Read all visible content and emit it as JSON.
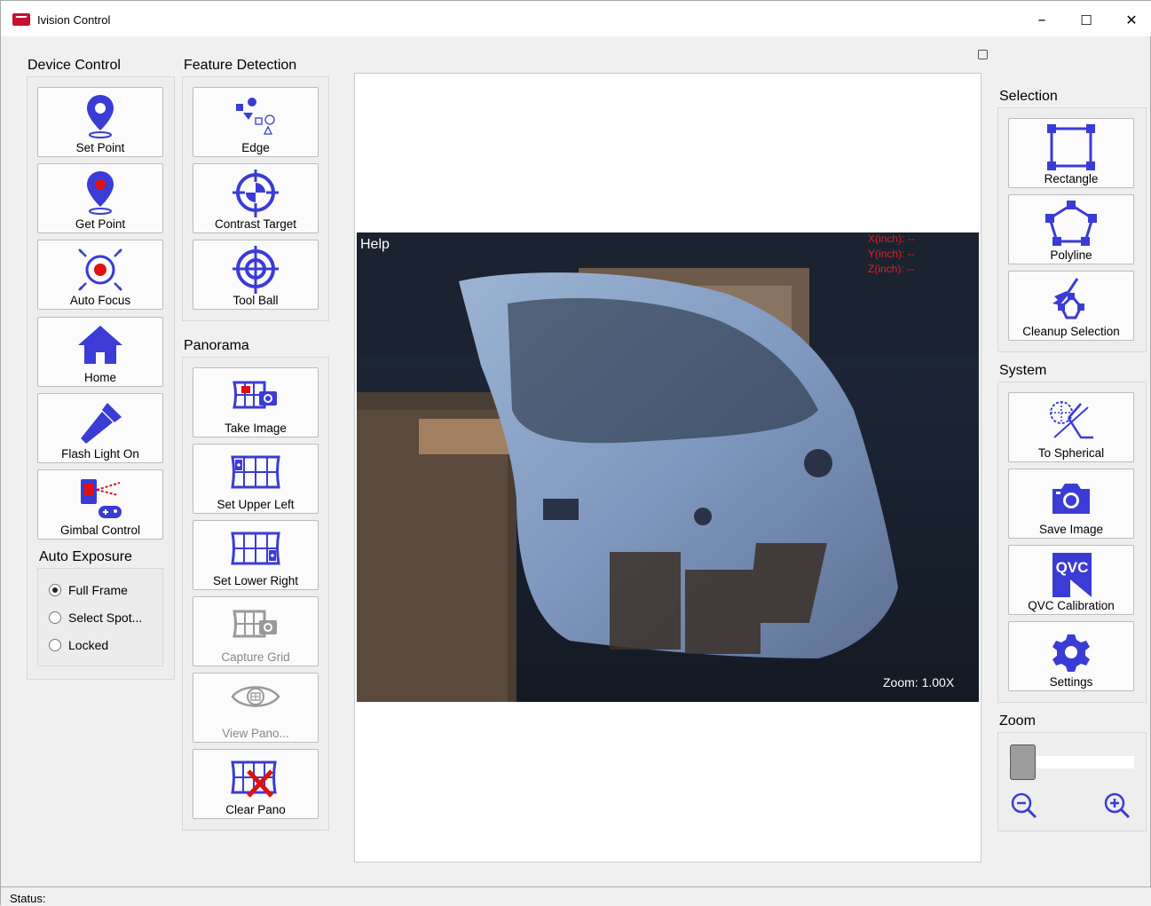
{
  "window": {
    "title": "Ivision Control",
    "min": "–",
    "max": "☐",
    "close": "✕"
  },
  "device_control": {
    "title": "Device Control",
    "buttons": [
      {
        "label": "Set Point",
        "icon": "map-pin-icon"
      },
      {
        "label": "Get Point",
        "icon": "map-pin-red-icon"
      },
      {
        "label": "Auto Focus",
        "icon": "focus-target-icon"
      },
      {
        "label": "Home",
        "icon": "home-icon"
      },
      {
        "label": "Flash Light On",
        "icon": "flashlight-icon"
      },
      {
        "label": "Gimbal Control",
        "icon": "gimbal-gamepad-icon"
      }
    ]
  },
  "auto_exposure": {
    "title": "Auto Exposure",
    "options": [
      {
        "label": "Full Frame",
        "selected": true
      },
      {
        "label": "Select Spot...",
        "selected": false
      },
      {
        "label": "Locked",
        "selected": false
      }
    ]
  },
  "feature_detection": {
    "title": "Feature Detection",
    "buttons": [
      {
        "label": "Edge",
        "icon": "shapes-icon"
      },
      {
        "label": "Contrast Target",
        "icon": "contrast-target-icon"
      },
      {
        "label": "Tool Ball",
        "icon": "crosshair-icon"
      }
    ]
  },
  "panorama": {
    "title": "Panorama",
    "buttons": [
      {
        "label": "Take Image",
        "icon": "pano-camera-icon",
        "enabled": true
      },
      {
        "label": "Set Upper Left",
        "icon": "grid-upper-left-icon",
        "enabled": true
      },
      {
        "label": "Set Lower Right",
        "icon": "grid-lower-right-icon",
        "enabled": true
      },
      {
        "label": "Capture Grid",
        "icon": "grid-camera-icon",
        "enabled": false
      },
      {
        "label": "View Pano...",
        "icon": "eye-pano-icon",
        "enabled": false
      },
      {
        "label": "Clear Pano",
        "icon": "grid-clear-icon",
        "enabled": true
      }
    ]
  },
  "viewer": {
    "help": "Help",
    "x_label": "X(inch): --",
    "y_label": "Y(inch): --",
    "z_label": "Z(inch): --",
    "zoom": "Zoom: 1.00X"
  },
  "selection": {
    "title": "Selection",
    "buttons": [
      {
        "label": "Rectangle",
        "icon": "rectangle-select-icon"
      },
      {
        "label": "Polyline",
        "icon": "polyline-select-icon"
      },
      {
        "label": "Cleanup Selection",
        "icon": "broom-icon"
      }
    ]
  },
  "system": {
    "title": "System",
    "buttons": [
      {
        "label": "To Spherical",
        "icon": "spherical-icon"
      },
      {
        "label": "Save Image",
        "icon": "camera-icon"
      },
      {
        "label": "QVC Calibration",
        "icon": "qvc-icon",
        "badge": "QVC"
      },
      {
        "label": "Settings",
        "icon": "gear-icon"
      }
    ]
  },
  "zoom_panel": {
    "title": "Zoom",
    "slider_level": 0
  },
  "status": {
    "label": "Status:"
  },
  "colors": {
    "accent": "#3b3bd6",
    "red": "#e01010"
  }
}
